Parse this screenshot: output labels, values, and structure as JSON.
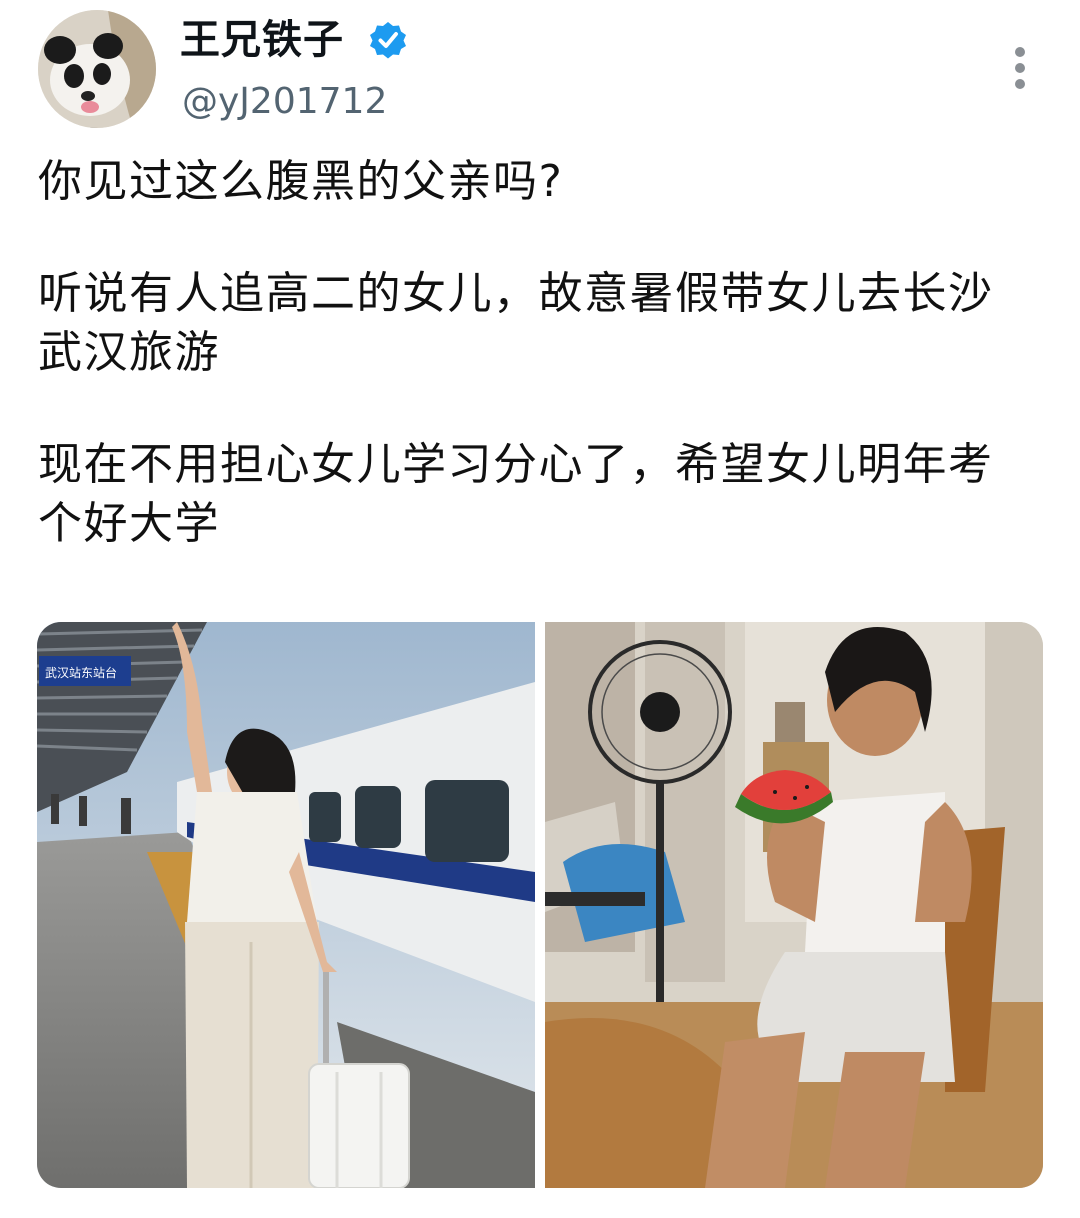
{
  "post": {
    "author": {
      "display_name": "王兄铁子",
      "handle": "@yJ201712",
      "verified": true,
      "avatar_icon": "panda-avatar"
    },
    "paragraphs": [
      "你见过这么腹黑的父亲吗?",
      "听说有人追高二的女儿，故意暑假带女儿去长沙武汉旅游",
      "现在不用担心女儿学习分心了，希望女儿明年考个好大学"
    ],
    "media": {
      "left_sign": "武汉站东站台"
    }
  },
  "colors": {
    "verified_blue": "#1d9bf0",
    "handle_gray": "#536471",
    "text": "#111111"
  }
}
